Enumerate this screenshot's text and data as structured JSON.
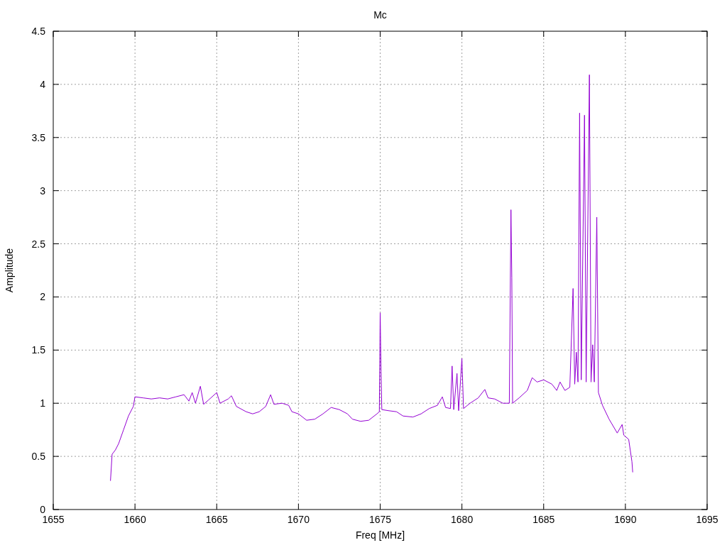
{
  "chart": {
    "chart_data": {
      "type": "line",
      "title": "Mc",
      "xlabel": "Freq [MHz]",
      "ylabel": "Amplitude",
      "x": [
        1658.5,
        1658.6,
        1658.8,
        1659.0,
        1659.3,
        1659.6,
        1659.9,
        1660.0,
        1660.5,
        1661,
        1661.5,
        1662,
        1662.5,
        1663,
        1663.3,
        1663.5,
        1663.7,
        1664,
        1664.2,
        1664.5,
        1665,
        1665.2,
        1665.7,
        1665.9,
        1666.2,
        1666.8,
        1667.2,
        1667.6,
        1668,
        1668.3,
        1668.5,
        1669,
        1669.4,
        1669.6,
        1670,
        1670.5,
        1671,
        1671.5,
        1672,
        1672.5,
        1673,
        1673.3,
        1673.8,
        1674.3,
        1674.8,
        1674.95,
        1675.0,
        1675.05,
        1675.1,
        1675.5,
        1676,
        1676.4,
        1677,
        1677.5,
        1678,
        1678.5,
        1678.8,
        1679,
        1679.3,
        1679.4,
        1679.5,
        1679.7,
        1679.8,
        1680.0,
        1680.1,
        1680.5,
        1681,
        1681.4,
        1681.6,
        1682,
        1682.5,
        1682.9,
        1683.0,
        1683.05,
        1683.1,
        1683.5,
        1684,
        1684.3,
        1684.6,
        1685,
        1685.5,
        1685.8,
        1686.0,
        1686.3,
        1686.6,
        1686.8,
        1686.9,
        1687.0,
        1687.1,
        1687.2,
        1687.3,
        1687.5,
        1687.6,
        1687.8,
        1687.9,
        1688.0,
        1688.1,
        1688.25,
        1688.35,
        1688.6,
        1689,
        1689.5,
        1689.8,
        1689.9,
        1690.2,
        1690.4,
        1690.45
      ],
      "series": [
        {
          "color": "#9400d3",
          "values": [
            0.27,
            0.52,
            0.56,
            0.62,
            0.75,
            0.88,
            0.97,
            1.06,
            1.05,
            1.04,
            1.05,
            1.04,
            1.06,
            1.08,
            1.02,
            1.1,
            1.0,
            1.16,
            0.99,
            1.03,
            1.1,
            1.0,
            1.04,
            1.07,
            0.97,
            0.92,
            0.9,
            0.92,
            0.97,
            1.08,
            0.99,
            1.0,
            0.98,
            0.92,
            0.9,
            0.84,
            0.85,
            0.9,
            0.96,
            0.94,
            0.9,
            0.85,
            0.83,
            0.84,
            0.9,
            0.92,
            1.85,
            1.3,
            0.94,
            0.93,
            0.92,
            0.88,
            0.87,
            0.9,
            0.95,
            0.98,
            1.06,
            0.96,
            0.95,
            1.35,
            0.94,
            1.28,
            0.93,
            1.42,
            0.95,
            1.0,
            1.05,
            1.13,
            1.05,
            1.04,
            1.0,
            1.0,
            2.82,
            2.18,
            1.0,
            1.05,
            1.12,
            1.24,
            1.2,
            1.22,
            1.18,
            1.12,
            1.2,
            1.12,
            1.15,
            2.08,
            1.18,
            1.48,
            1.2,
            3.73,
            1.22,
            3.71,
            1.2,
            4.09,
            1.2,
            1.55,
            1.2,
            2.75,
            1.1,
            0.98,
            0.85,
            0.72,
            0.8,
            0.7,
            0.66,
            0.45,
            0.35
          ]
        }
      ],
      "grid": true,
      "xlim": [
        1655,
        1695
      ],
      "ylim": [
        0,
        4.5
      ],
      "xticks": [
        1655,
        1660,
        1665,
        1670,
        1675,
        1680,
        1685,
        1690,
        1695
      ],
      "yticks": [
        0,
        0.5,
        1,
        1.5,
        2,
        2.5,
        3,
        3.5,
        4,
        4.5
      ]
    }
  }
}
